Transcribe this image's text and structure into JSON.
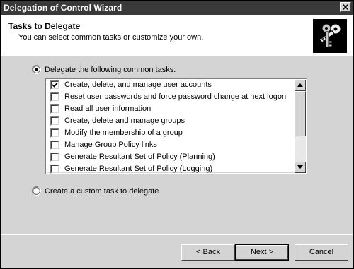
{
  "window": {
    "title": "Delegation of Control Wizard"
  },
  "header": {
    "title": "Tasks to Delegate",
    "subtitle": "You can select common tasks or customize your own."
  },
  "options": {
    "common": {
      "label": "Delegate the following common tasks:",
      "selected": true
    },
    "custom": {
      "label": "Create a custom task to delegate",
      "selected": false
    }
  },
  "tasks": [
    {
      "label": "Create, delete, and manage user accounts",
      "checked": true
    },
    {
      "label": "Reset user passwords and force password change at next logon",
      "checked": false
    },
    {
      "label": "Read all user information",
      "checked": false
    },
    {
      "label": "Create, delete and manage groups",
      "checked": false
    },
    {
      "label": "Modify the membership of a group",
      "checked": false
    },
    {
      "label": "Manage Group Policy links",
      "checked": false
    },
    {
      "label": "Generate Resultant Set of Policy (Planning)",
      "checked": false
    },
    {
      "label": "Generate Resultant Set of Policy (Logging)",
      "checked": false
    }
  ],
  "buttons": {
    "back": "< Back",
    "next": "Next >",
    "cancel": "Cancel"
  },
  "icons": {
    "close": "close-icon",
    "keys": "keys-icon"
  }
}
